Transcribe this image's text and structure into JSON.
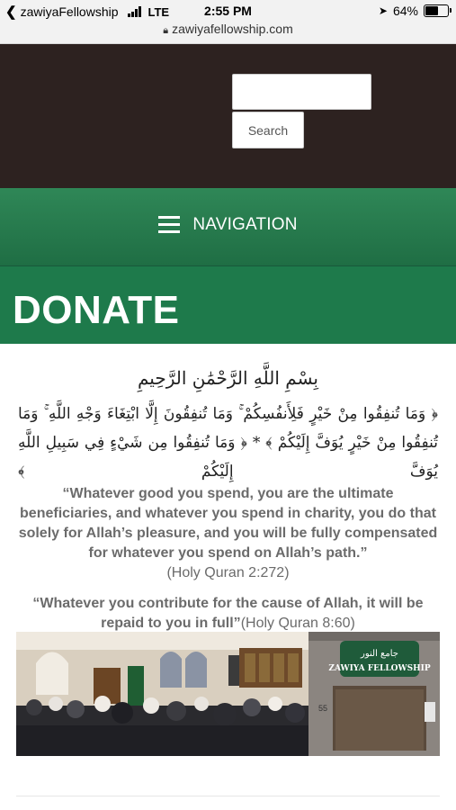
{
  "status_bar": {
    "back_app": "zawiyaFellowship",
    "network": "LTE",
    "time": "2:55 PM",
    "battery": "64%",
    "battery_level": 0.64
  },
  "url_bar": {
    "url": "zawiyafellowship.com"
  },
  "header": {
    "search_placeholder": "",
    "search_button": "Search"
  },
  "nav": {
    "label": "NAVIGATION"
  },
  "page": {
    "title": "DONATE"
  },
  "content": {
    "bismillah": "بِسْمِ اللَّهِ الرَّحْمَٰنِ الرَّحِيمِ",
    "arabic_verses": "﴿ وَمَا تُنفِقُوا مِنْ خَيْرٍ فَلِأَنفُسِكُمْ ۚ وَمَا تُنفِقُونَ إِلَّا ابْتِغَاءَ وَجْهِ اللَّهِ ۚ وَمَا تُنفِقُوا مِنْ خَيْرٍ يُوَفَّ إِلَيْكُمْ ﴾ * ﴿ وَمَا تُنفِقُوا مِن شَيْءٍ فِي سَبِيلِ اللَّهِ يُوَفَّ إِلَيْكُمْ ﴾",
    "quote1_text": "“Whatever good you spend, you are the ultimate beneficiaries, and whatever you spend in charity, you do that solely for Allah’s pleasure, and you will be fully compensated for whatever you spend on Allah’s path.”",
    "quote1_ref": "(Holy Quran 2:272)",
    "quote2_text": "“Whatever you contribute for the cause of Allah, it will be repaid to you in full”",
    "quote2_ref": "(Holy Quran 8:60)",
    "sign_arabic": "جامع النور",
    "sign_english": "ZAWIYA FELLOWSHIP",
    "building_number": "55"
  },
  "colors": {
    "header_bg": "#2d2220",
    "nav_green": "#2f8757",
    "title_green": "#1e7a4b",
    "quote_gray": "#6b6b6b"
  },
  "icons": [
    "back-chevron-icon",
    "signal-icon",
    "location-arrow-icon",
    "battery-icon",
    "lock-icon",
    "hamburger-icon"
  ]
}
